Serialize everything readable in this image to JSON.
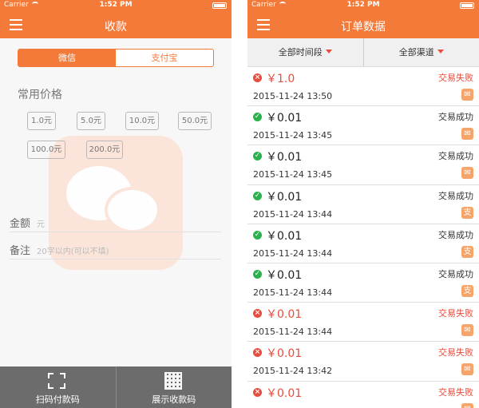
{
  "status_bar": {
    "carrier": "Carrier",
    "time": "1:52 PM"
  },
  "left": {
    "title": "收款",
    "tabs": [
      {
        "label": "微信",
        "active": true
      },
      {
        "label": "支付宝",
        "active": false
      }
    ],
    "section_title": "常用价格",
    "prices": [
      "1.0元",
      "5.0元",
      "10.0元",
      "50.0元",
      "100.0元",
      "200.0元"
    ],
    "amount": {
      "label": "金额",
      "placeholder": "元"
    },
    "note": {
      "label": "备注",
      "placeholder": "20字以内(可以不填)"
    },
    "bottom": {
      "scan_label": "扫码付款码",
      "qr_label": "展示收款码"
    }
  },
  "right": {
    "title": "订单数据",
    "filters": {
      "time": "全部时间段",
      "channel": "全部渠道"
    },
    "orders": [
      {
        "ok": false,
        "amount": "￥1.0",
        "datetime": "2015-11-24 13:50",
        "status": "交易失败",
        "channel": "wechat",
        "channel_glyph": "✉"
      },
      {
        "ok": true,
        "amount": "￥0.01",
        "datetime": "2015-11-24 13:45",
        "status": "交易成功",
        "channel": "wechat",
        "channel_glyph": "✉"
      },
      {
        "ok": true,
        "amount": "￥0.01",
        "datetime": "2015-11-24 13:45",
        "status": "交易成功",
        "channel": "wechat",
        "channel_glyph": "✉"
      },
      {
        "ok": true,
        "amount": "￥0.01",
        "datetime": "2015-11-24 13:44",
        "status": "交易成功",
        "channel": "alipay",
        "channel_glyph": "支"
      },
      {
        "ok": true,
        "amount": "￥0.01",
        "datetime": "2015-11-24 13:44",
        "status": "交易成功",
        "channel": "alipay",
        "channel_glyph": "支"
      },
      {
        "ok": true,
        "amount": "￥0.01",
        "datetime": "2015-11-24 13:44",
        "status": "交易成功",
        "channel": "alipay",
        "channel_glyph": "支"
      },
      {
        "ok": false,
        "amount": "￥0.01",
        "datetime": "2015-11-24 13:44",
        "status": "交易失败",
        "channel": "wechat",
        "channel_glyph": "✉"
      },
      {
        "ok": false,
        "amount": "￥0.01",
        "datetime": "2015-11-24 13:42",
        "status": "交易失败",
        "channel": "wechat",
        "channel_glyph": "✉"
      },
      {
        "ok": false,
        "amount": "￥0.01",
        "datetime": "",
        "status": "交易失败",
        "channel": "wechat",
        "channel_glyph": "✉"
      }
    ]
  },
  "colors": {
    "accent": "#f47a3a",
    "success": "#2bb24c",
    "fail": "#e84c3d"
  }
}
